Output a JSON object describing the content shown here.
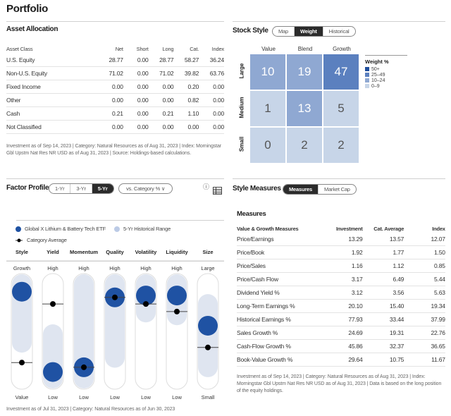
{
  "page": {
    "title": "Portfolio"
  },
  "asset_allocation": {
    "title": "Asset Allocation",
    "columns": [
      "Asset Class",
      "Net",
      "Short",
      "Long",
      "Cat.",
      "Index"
    ],
    "rows": [
      {
        "name": "U.S. Equity",
        "net": "28.77",
        "short": "0.00",
        "long": "28.77",
        "cat": "58.27",
        "index": "36.24"
      },
      {
        "name": "Non-U.S. Equity",
        "net": "71.02",
        "short": "0.00",
        "long": "71.02",
        "cat": "39.82",
        "index": "63.76"
      },
      {
        "name": "Fixed Income",
        "net": "0.00",
        "short": "0.00",
        "long": "0.00",
        "cat": "0.20",
        "index": "0.00"
      },
      {
        "name": "Other",
        "net": "0.00",
        "short": "0.00",
        "long": "0.00",
        "cat": "0.82",
        "index": "0.00"
      },
      {
        "name": "Cash",
        "net": "0.21",
        "short": "0.00",
        "long": "0.21",
        "cat": "1.10",
        "index": "0.00"
      },
      {
        "name": "Not Classified",
        "net": "0.00",
        "short": "0.00",
        "long": "0.00",
        "cat": "0.00",
        "index": "0.00"
      }
    ],
    "footnote": "Investment as of Sep 14, 2023 | Category: Natural Resources as of Aug 31, 2023 | Index: Morningstar Gbl Upstm Nat Res NR USD as of Aug 31, 2023 | Source: Holdings-based calculations."
  },
  "stock_style": {
    "title": "Stock Style",
    "tabs": [
      {
        "label": "Map",
        "active": false
      },
      {
        "label": "Weight",
        "active": true
      },
      {
        "label": "Historical",
        "active": false
      }
    ],
    "columns": [
      "Value",
      "Blend",
      "Growth"
    ],
    "rows": [
      "Large",
      "Medium",
      "Small"
    ],
    "cells": [
      [
        {
          "value": "10",
          "color": "#8fa8d2"
        },
        {
          "value": "19",
          "color": "#8fa8d2"
        },
        {
          "value": "47",
          "color": "#5b80bf"
        }
      ],
      [
        {
          "value": "1",
          "color": "#c7d5e8"
        },
        {
          "value": "13",
          "color": "#8fa8d2"
        },
        {
          "value": "5",
          "color": "#c7d5e8"
        }
      ],
      [
        {
          "value": "0",
          "color": "#c7d5e8"
        },
        {
          "value": "2",
          "color": "#c7d5e8"
        },
        {
          "value": "2",
          "color": "#c7d5e8"
        }
      ]
    ],
    "legend": {
      "title": "Weight %",
      "items": [
        {
          "label": "50+",
          "color": "#1f4e9c"
        },
        {
          "label": "25–49",
          "color": "#5b80bf"
        },
        {
          "label": "10–24",
          "color": "#8fa8d2"
        },
        {
          "label": "0–9",
          "color": "#c7d5e8"
        }
      ]
    }
  },
  "factor_profile": {
    "title": "Factor Profile",
    "period_tabs": [
      {
        "label": "1-Yr",
        "active": false
      },
      {
        "label": "3-Yr",
        "active": false
      },
      {
        "label": "5-Yr",
        "active": true
      }
    ],
    "compare_dropdown": "vs. Category % ∨",
    "info_icon": "ⓘ",
    "legend": {
      "fund": "Global X Lithium & Battery Tech ETF",
      "range": "5-Yr Historical Range",
      "category": "Category Average"
    },
    "colors": {
      "fund": "#1f52a3",
      "range": "#dfe5f0",
      "category": "#000000"
    },
    "factors": [
      {
        "name": "Style",
        "top": "Growth",
        "bottom": "Value",
        "fund": 0.92,
        "cat": 0.17,
        "range": [
          0.38,
          1.0
        ]
      },
      {
        "name": "Yield",
        "top": "High",
        "bottom": "Low",
        "fund": 0.07,
        "cat": 0.79,
        "range": [
          0.0,
          0.47
        ]
      },
      {
        "name": "Momentum",
        "top": "High",
        "bottom": "Low",
        "fund": 0.12,
        "cat": 0.12,
        "range": [
          0.0,
          1.0
        ]
      },
      {
        "name": "Quality",
        "top": "High",
        "bottom": "Low",
        "fund": 0.86,
        "cat": 0.86,
        "range": [
          0.22,
          1.0
        ]
      },
      {
        "name": "Volatility",
        "top": "High",
        "bottom": "Low",
        "fund": 0.88,
        "cat": 0.79,
        "range": [
          0.7,
          1.0
        ]
      },
      {
        "name": "Liquidity",
        "top": "High",
        "bottom": "Low",
        "fund": 0.88,
        "cat": 0.71,
        "range": [
          0.67,
          1.0
        ]
      },
      {
        "name": "Size",
        "top": "Large",
        "bottom": "Small",
        "fund": 0.56,
        "cat": 0.33,
        "range": [
          0.12,
          0.79
        ]
      }
    ],
    "footnote": "Investment as of Jul 31, 2023 | Category: Natural Resources as of Jun 30, 2023"
  },
  "style_measures": {
    "title": "Style Measures",
    "tabs": [
      {
        "label": "Measures",
        "active": true
      },
      {
        "label": "Market Cap",
        "active": false
      }
    ],
    "subtitle": "Measures",
    "columns": [
      "Value & Growth Measures",
      "Investment",
      "Cat. Average",
      "Index"
    ],
    "rows": [
      {
        "name": "Price/Earnings",
        "inv": "13.29",
        "cat": "13.57",
        "index": "12.07"
      },
      {
        "name": "Price/Book",
        "inv": "1.92",
        "cat": "1.77",
        "index": "1.50"
      },
      {
        "name": "Price/Sales",
        "inv": "1.16",
        "cat": "1.12",
        "index": "0.85"
      },
      {
        "name": "Price/Cash Flow",
        "inv": "3.17",
        "cat": "6.49",
        "index": "5.44"
      },
      {
        "name": "Dividend Yield %",
        "inv": "3.12",
        "cat": "3.56",
        "index": "5.63"
      },
      {
        "name": "Long-Term Earnings %",
        "inv": "20.10",
        "cat": "15.40",
        "index": "19.34"
      },
      {
        "name": "Historical Earnings %",
        "inv": "77.93",
        "cat": "33.44",
        "index": "37.99"
      },
      {
        "name": "Sales Growth %",
        "inv": "24.69",
        "cat": "19.31",
        "index": "22.76"
      },
      {
        "name": "Cash-Flow Growth %",
        "inv": "45.86",
        "cat": "32.37",
        "index": "36.65"
      },
      {
        "name": "Book-Value Growth %",
        "inv": "29.64",
        "cat": "10.75",
        "index": "11.67"
      }
    ],
    "footnote": "Investment as of Sep 14, 2023 | Category: Natural Resources as of Aug 31, 2023 | Index: Morningstar Gbl Upstm Nat Res NR USD as of Aug 31, 2023 | Data is based on the long position of the equity holdings."
  }
}
